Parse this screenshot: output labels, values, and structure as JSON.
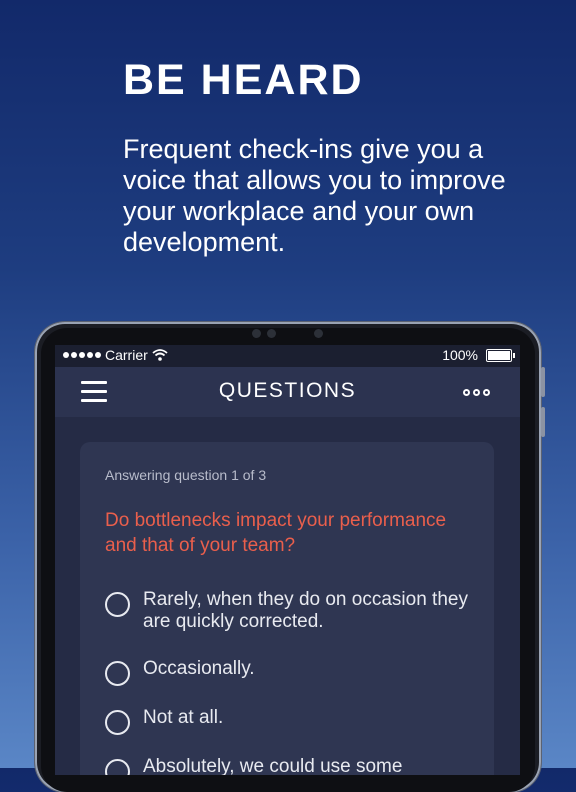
{
  "marketing": {
    "headline": "BE HEARD",
    "subtitle": "Frequent check-ins give you a voice that allows you to improve your workplace and your own development."
  },
  "statusbar": {
    "carrier": "Carrier",
    "battery": "100%"
  },
  "navbar": {
    "title": "QUESTIONS",
    "menu_icon": "hamburger-icon",
    "more_icon": "more-icon"
  },
  "survey": {
    "progress": "Answering question 1 of 3",
    "question": "Do bottlenecks impact your performance and that of your team?",
    "options": [
      "Rarely, when they do on occasion they are quickly corrected.",
      "Occasionally.",
      "Not at all.",
      "Absolutely, we could use some"
    ]
  },
  "colors": {
    "question": "#ea5f4c",
    "screen_bg": "#252b45",
    "card_bg": "#2f3652"
  }
}
